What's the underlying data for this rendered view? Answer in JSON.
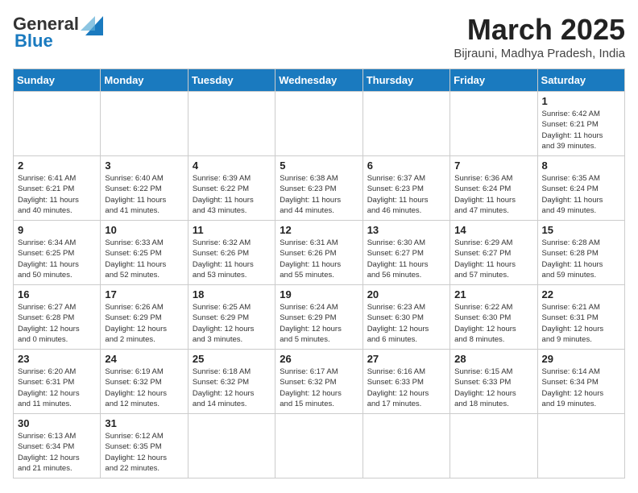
{
  "header": {
    "logo_general": "General",
    "logo_blue": "Blue",
    "title": "March 2025",
    "subtitle": "Bijrauni, Madhya Pradesh, India"
  },
  "weekdays": [
    "Sunday",
    "Monday",
    "Tuesday",
    "Wednesday",
    "Thursday",
    "Friday",
    "Saturday"
  ],
  "weeks": [
    [
      {
        "day": "",
        "info": ""
      },
      {
        "day": "",
        "info": ""
      },
      {
        "day": "",
        "info": ""
      },
      {
        "day": "",
        "info": ""
      },
      {
        "day": "",
        "info": ""
      },
      {
        "day": "",
        "info": ""
      },
      {
        "day": "1",
        "info": "Sunrise: 6:42 AM\nSunset: 6:21 PM\nDaylight: 11 hours\nand 39 minutes."
      }
    ],
    [
      {
        "day": "2",
        "info": "Sunrise: 6:41 AM\nSunset: 6:21 PM\nDaylight: 11 hours\nand 40 minutes."
      },
      {
        "day": "3",
        "info": "Sunrise: 6:40 AM\nSunset: 6:22 PM\nDaylight: 11 hours\nand 41 minutes."
      },
      {
        "day": "4",
        "info": "Sunrise: 6:39 AM\nSunset: 6:22 PM\nDaylight: 11 hours\nand 43 minutes."
      },
      {
        "day": "5",
        "info": "Sunrise: 6:38 AM\nSunset: 6:23 PM\nDaylight: 11 hours\nand 44 minutes."
      },
      {
        "day": "6",
        "info": "Sunrise: 6:37 AM\nSunset: 6:23 PM\nDaylight: 11 hours\nand 46 minutes."
      },
      {
        "day": "7",
        "info": "Sunrise: 6:36 AM\nSunset: 6:24 PM\nDaylight: 11 hours\nand 47 minutes."
      },
      {
        "day": "8",
        "info": "Sunrise: 6:35 AM\nSunset: 6:24 PM\nDaylight: 11 hours\nand 49 minutes."
      }
    ],
    [
      {
        "day": "9",
        "info": "Sunrise: 6:34 AM\nSunset: 6:25 PM\nDaylight: 11 hours\nand 50 minutes."
      },
      {
        "day": "10",
        "info": "Sunrise: 6:33 AM\nSunset: 6:25 PM\nDaylight: 11 hours\nand 52 minutes."
      },
      {
        "day": "11",
        "info": "Sunrise: 6:32 AM\nSunset: 6:26 PM\nDaylight: 11 hours\nand 53 minutes."
      },
      {
        "day": "12",
        "info": "Sunrise: 6:31 AM\nSunset: 6:26 PM\nDaylight: 11 hours\nand 55 minutes."
      },
      {
        "day": "13",
        "info": "Sunrise: 6:30 AM\nSunset: 6:27 PM\nDaylight: 11 hours\nand 56 minutes."
      },
      {
        "day": "14",
        "info": "Sunrise: 6:29 AM\nSunset: 6:27 PM\nDaylight: 11 hours\nand 57 minutes."
      },
      {
        "day": "15",
        "info": "Sunrise: 6:28 AM\nSunset: 6:28 PM\nDaylight: 11 hours\nand 59 minutes."
      }
    ],
    [
      {
        "day": "16",
        "info": "Sunrise: 6:27 AM\nSunset: 6:28 PM\nDaylight: 12 hours\nand 0 minutes."
      },
      {
        "day": "17",
        "info": "Sunrise: 6:26 AM\nSunset: 6:29 PM\nDaylight: 12 hours\nand 2 minutes."
      },
      {
        "day": "18",
        "info": "Sunrise: 6:25 AM\nSunset: 6:29 PM\nDaylight: 12 hours\nand 3 minutes."
      },
      {
        "day": "19",
        "info": "Sunrise: 6:24 AM\nSunset: 6:29 PM\nDaylight: 12 hours\nand 5 minutes."
      },
      {
        "day": "20",
        "info": "Sunrise: 6:23 AM\nSunset: 6:30 PM\nDaylight: 12 hours\nand 6 minutes."
      },
      {
        "day": "21",
        "info": "Sunrise: 6:22 AM\nSunset: 6:30 PM\nDaylight: 12 hours\nand 8 minutes."
      },
      {
        "day": "22",
        "info": "Sunrise: 6:21 AM\nSunset: 6:31 PM\nDaylight: 12 hours\nand 9 minutes."
      }
    ],
    [
      {
        "day": "23",
        "info": "Sunrise: 6:20 AM\nSunset: 6:31 PM\nDaylight: 12 hours\nand 11 minutes."
      },
      {
        "day": "24",
        "info": "Sunrise: 6:19 AM\nSunset: 6:32 PM\nDaylight: 12 hours\nand 12 minutes."
      },
      {
        "day": "25",
        "info": "Sunrise: 6:18 AM\nSunset: 6:32 PM\nDaylight: 12 hours\nand 14 minutes."
      },
      {
        "day": "26",
        "info": "Sunrise: 6:17 AM\nSunset: 6:32 PM\nDaylight: 12 hours\nand 15 minutes."
      },
      {
        "day": "27",
        "info": "Sunrise: 6:16 AM\nSunset: 6:33 PM\nDaylight: 12 hours\nand 17 minutes."
      },
      {
        "day": "28",
        "info": "Sunrise: 6:15 AM\nSunset: 6:33 PM\nDaylight: 12 hours\nand 18 minutes."
      },
      {
        "day": "29",
        "info": "Sunrise: 6:14 AM\nSunset: 6:34 PM\nDaylight: 12 hours\nand 19 minutes."
      }
    ],
    [
      {
        "day": "30",
        "info": "Sunrise: 6:13 AM\nSunset: 6:34 PM\nDaylight: 12 hours\nand 21 minutes."
      },
      {
        "day": "31",
        "info": "Sunrise: 6:12 AM\nSunset: 6:35 PM\nDaylight: 12 hours\nand 22 minutes."
      },
      {
        "day": "",
        "info": ""
      },
      {
        "day": "",
        "info": ""
      },
      {
        "day": "",
        "info": ""
      },
      {
        "day": "",
        "info": ""
      },
      {
        "day": "",
        "info": ""
      }
    ]
  ]
}
